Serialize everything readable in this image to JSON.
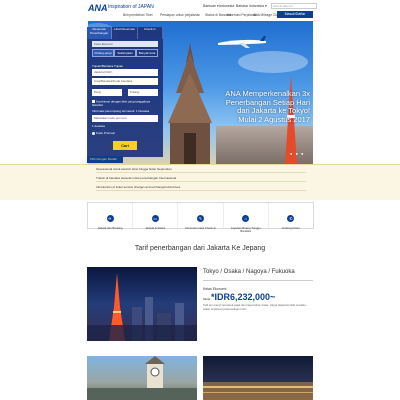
{
  "header": {
    "logo": "ANA",
    "tagline": "Inspiration of JAPAN",
    "utilities": [
      "Bantuan ▾",
      "Indonesia",
      "Bahasa Indonesia ▾"
    ],
    "search_placeholder": "Cari di situs ini",
    "nav_items": [
      "Beli pembelian Tiket",
      "Persiapan untuk perjalanan",
      "Status di Bandara",
      "Informasi Perjalanan",
      "ANA Mileage Club"
    ],
    "nav_button": "Masuk/Daftar"
  },
  "hero": {
    "headline_lines": [
      "ANA Memperkenalkan 3x",
      "Penerbangan Setiap Hari",
      "dari Jakarta ke Tokyo!",
      "Mulai 2 Agustus 2017"
    ],
    "dots": "● ● ●",
    "ticker": "Pilih Dengan Mudah"
  },
  "booking": {
    "tabs": [
      "Reservasi Penerbangan",
      "Lihat Reservasi",
      "Check-in"
    ],
    "cabin": "Kelas Ekonomi",
    "trip_types": [
      "Pulang-pergi",
      "Sekali jalan",
      "Banyak kota"
    ],
    "from_value": "Jakarta(CGK)",
    "to_label": "Tujuan/Bandara Tujuan",
    "to_placeholder": "Kota/Bandara/Kode bandara",
    "depart_date": "Pergi",
    "return_date": "Pulang",
    "checkbox_label": "Kombinasi dengan tiket yang tanggalnya fleksibel",
    "passengers_label": "Informasi penumpang termasuk: 1 Dewasa",
    "promo_placeholder": "Masukkan kode promosi",
    "passenger_summary": "1 dewasa",
    "radio_label": "Kode Promosi",
    "submit": "Cari"
  },
  "notices": [
    "Operasional untuk seluruh loket hingga bulan September",
    "Transit di bandara Haneda untuk penerbangan Internasional",
    "Introduction of ticket service charges and exchange/refund fees"
  ],
  "quick_links": [
    {
      "icon": "✈",
      "label": "Jadwal dan Booking"
    },
    {
      "icon": "▭",
      "label": "Jadwal & Status"
    },
    {
      "icon": "✎",
      "label": "Informasi untuk Check-in"
    },
    {
      "icon": "⌂",
      "label": "Layanan Ruang Tunggu Bandara"
    },
    {
      "icon": "✆",
      "label": "Hubungi Kami"
    }
  ],
  "section_title": "Tarif penerbangan dari Jakarta Ke Jepang",
  "fare": {
    "route": "Tokyo / Osaka / Nagoya / Fukuoka",
    "class": "Kelas Ekonomi",
    "from_label": "Mulai",
    "price": "*IDR6,232,000~",
    "note": "Tarif per orang* termasuk pajak dan biaya bahan bakar.\nHarga dapat berubah sewaktu-waktu tergantung ketersediaan kursi."
  }
}
